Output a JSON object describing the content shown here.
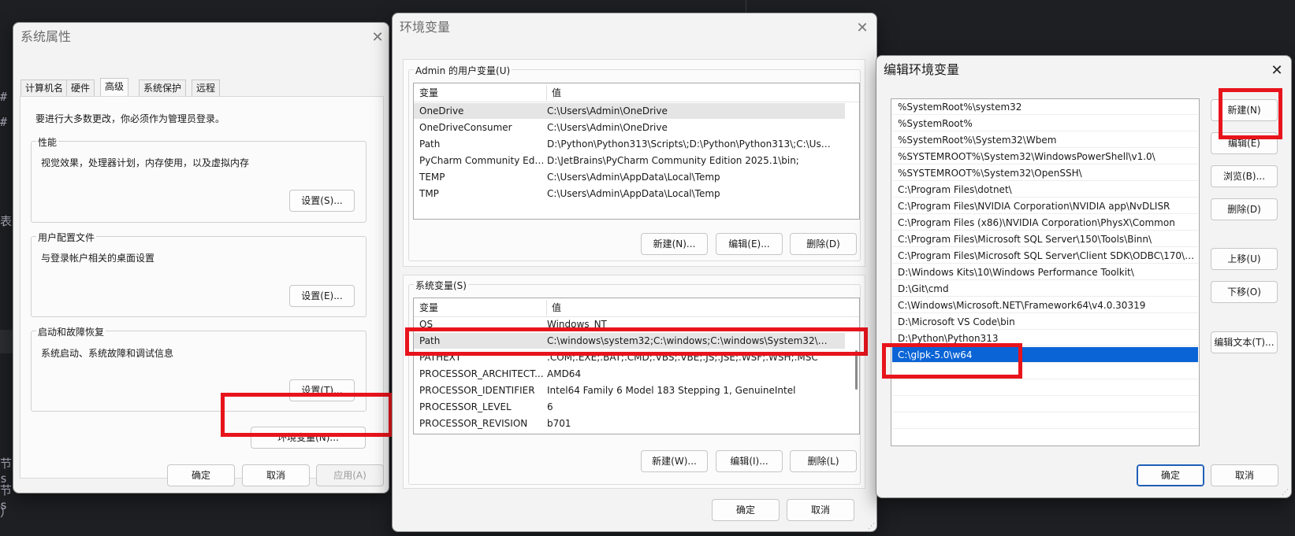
{
  "background": {
    "editor_lines": [
      "#",
      "#",
      "表",
      "节s",
      "节s",
      "）"
    ]
  },
  "sys_props": {
    "title": "系统属性",
    "tabs": [
      "计算机名",
      "硬件",
      "高级",
      "系统保护",
      "远程"
    ],
    "selected_tab": "高级",
    "admin_note": "要进行大多数更改，你必须作为管理员登录。",
    "perf": {
      "label": "性能",
      "desc": "视觉效果，处理器计划，内存使用，以及虚拟内存",
      "button": "设置(S)..."
    },
    "profile": {
      "label": "用户配置文件",
      "desc": "与登录帐户相关的桌面设置",
      "button": "设置(E)..."
    },
    "startup": {
      "label": "启动和故障恢复",
      "desc": "系统启动、系统故障和调试信息",
      "button": "设置(T)..."
    },
    "env_button": "环境变量(N)...",
    "ok": "确定",
    "cancel": "取消",
    "apply": "应用(A)"
  },
  "env_vars": {
    "title": "环境变量",
    "user_group": "Admin 的用户变量(U)",
    "col_var": "变量",
    "col_val": "值",
    "user_rows": [
      {
        "name": "OneDrive",
        "value": "C:\\Users\\Admin\\OneDrive"
      },
      {
        "name": "OneDriveConsumer",
        "value": "C:\\Users\\Admin\\OneDrive"
      },
      {
        "name": "Path",
        "value": "D:\\Python\\Python313\\Scripts\\;D:\\Python\\Python313\\;C:\\Users\\..."
      },
      {
        "name": "PyCharm Community Editi...",
        "value": "D:\\JetBrains\\PyCharm Community Edition 2025.1\\bin;"
      },
      {
        "name": "TEMP",
        "value": "C:\\Users\\Admin\\AppData\\Local\\Temp"
      },
      {
        "name": "TMP",
        "value": "C:\\Users\\Admin\\AppData\\Local\\Temp"
      }
    ],
    "user_new": "新建(N)...",
    "user_edit": "编辑(E)...",
    "user_delete": "删除(D)",
    "sys_group": "系统变量(S)",
    "sys_rows": [
      {
        "name": "OS",
        "value": "Windows_NT"
      },
      {
        "name": "Path",
        "value": "C:\\windows\\system32;C:\\windows;C:\\windows\\System32\\Wbe..."
      },
      {
        "name": "PATHEXT",
        "value": ".COM;.EXE;.BAT;.CMD;.VBS;.VBE;.JS;.JSE;.WSF;.WSH;.MSC"
      },
      {
        "name": "PROCESSOR_ARCHITECT...",
        "value": "AMD64"
      },
      {
        "name": "PROCESSOR_IDENTIFIER",
        "value": "Intel64 Family 6 Model 183 Stepping 1, GenuineIntel"
      },
      {
        "name": "PROCESSOR_LEVEL",
        "value": "6"
      },
      {
        "name": "PROCESSOR_REVISION",
        "value": "b701"
      }
    ],
    "sys_new": "新建(W)...",
    "sys_edit": "编辑(I)...",
    "sys_delete": "删除(L)",
    "ok": "确定",
    "cancel": "取消"
  },
  "edit_env": {
    "title": "编辑环境变量",
    "entries": [
      "%SystemRoot%\\system32",
      "%SystemRoot%",
      "%SystemRoot%\\System32\\Wbem",
      "%SYSTEMROOT%\\System32\\WindowsPowerShell\\v1.0\\",
      "%SYSTEMROOT%\\System32\\OpenSSH\\",
      "C:\\Program Files\\dotnet\\",
      "C:\\Program Files\\NVIDIA Corporation\\NVIDIA app\\NvDLISR",
      "C:\\Program Files (x86)\\NVIDIA Corporation\\PhysX\\Common",
      "C:\\Program Files\\Microsoft SQL Server\\150\\Tools\\Binn\\",
      "C:\\Program Files\\Microsoft SQL Server\\Client SDK\\ODBC\\170\\T...",
      "D:\\Windows Kits\\10\\Windows Performance Toolkit\\",
      "D:\\Git\\cmd",
      "C:\\Windows\\Microsoft.NET\\Framework64\\v4.0.30319",
      "D:\\Microsoft VS Code\\bin",
      "D:\\Python\\Python313",
      "C:\\glpk-5.0\\w64"
    ],
    "selected_entry": "C:\\glpk-5.0\\w64",
    "btn_new": "新建(N)",
    "btn_edit": "编辑(E)",
    "btn_browse": "浏览(B)...",
    "btn_delete": "删除(D)",
    "btn_up": "上移(U)",
    "btn_down": "下移(O)",
    "btn_edit_text": "编辑文本(T)...",
    "ok": "确定",
    "cancel": "取消"
  },
  "colors": {
    "highlight": "#e8141c",
    "selection": "#0a64d6"
  }
}
